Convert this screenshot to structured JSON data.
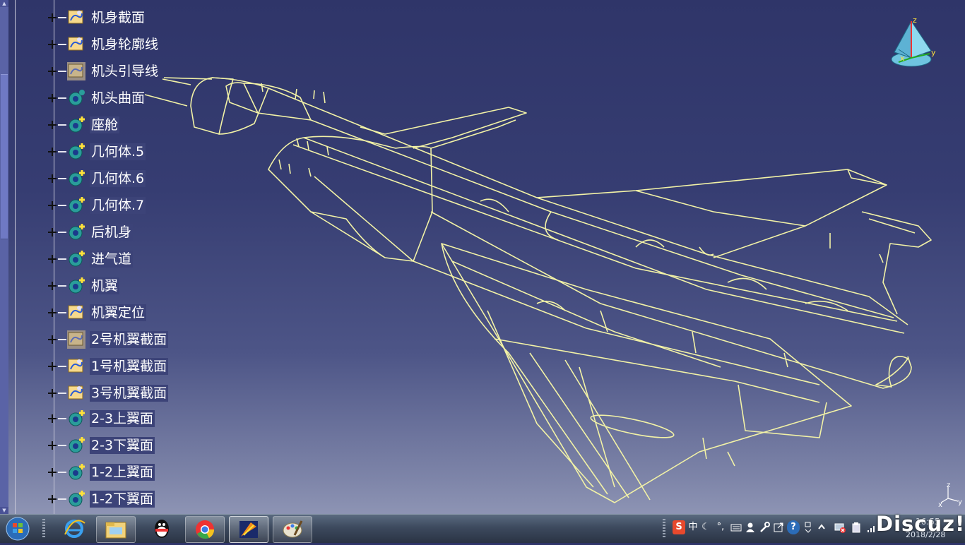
{
  "tree": {
    "items": [
      {
        "label": "机身截面",
        "icon": "sketch-icon",
        "highlighted": false
      },
      {
        "label": "机身轮廓线",
        "icon": "sketch-icon",
        "highlighted": false
      },
      {
        "label": "机头引导线",
        "icon": "hidden-sketch-icon",
        "highlighted": false
      },
      {
        "label": "机头曲面",
        "icon": "geometrical-set-icon",
        "highlighted": false
      },
      {
        "label": "座舱",
        "icon": "geometrical-set-icon",
        "highlighted": true
      },
      {
        "label": "几何体.5",
        "icon": "geometrical-set-icon",
        "highlighted": true
      },
      {
        "label": "几何体.6",
        "icon": "geometrical-set-icon",
        "highlighted": true
      },
      {
        "label": "几何体.7",
        "icon": "geometrical-set-icon",
        "highlighted": true
      },
      {
        "label": "后机身",
        "icon": "geometrical-set-icon",
        "highlighted": true
      },
      {
        "label": "进气道",
        "icon": "geometrical-set-icon",
        "highlighted": true
      },
      {
        "label": "机翼",
        "icon": "geometrical-set-icon",
        "highlighted": true
      },
      {
        "label": "机翼定位",
        "icon": "sketch-icon",
        "highlighted": true
      },
      {
        "label": "2号机翼截面",
        "icon": "hidden-sketch-icon",
        "highlighted": true
      },
      {
        "label": "1号机翼截面",
        "icon": "sketch-icon",
        "highlighted": true
      },
      {
        "label": "3号机翼截面",
        "icon": "sketch-icon",
        "highlighted": true
      },
      {
        "label": "2-3上翼面",
        "icon": "geometrical-set-icon",
        "highlighted": true
      },
      {
        "label": "2-3下翼面",
        "icon": "geometrical-set-icon",
        "highlighted": true
      },
      {
        "label": "1-2上翼面",
        "icon": "geometrical-set-icon",
        "highlighted": true
      },
      {
        "label": "1-2下翼面",
        "icon": "geometrical-set-icon",
        "highlighted": true
      }
    ]
  },
  "compass": {
    "x_label": "x",
    "y_label": "y",
    "z_label": "z"
  },
  "mini_axis": {
    "x_label": "x",
    "y_label": "y",
    "z_label": "z"
  },
  "colors": {
    "wireframe": "#f2f2a6",
    "background_top": "#2f3569",
    "background_bottom": "#9aa0bd",
    "label_highlight": "#3c4378"
  },
  "taskbar": {
    "apps": [
      {
        "name": "internet-explorer-icon"
      },
      {
        "name": "file-explorer-icon"
      },
      {
        "name": "qq-icon"
      },
      {
        "name": "chrome-icon"
      },
      {
        "name": "catia-icon"
      },
      {
        "name": "paint-icon"
      }
    ],
    "tray": {
      "ime_logo": "S",
      "ime_mode": "中",
      "moon": "☾",
      "punct": "°,",
      "help": "?"
    },
    "clock_time": "16:55",
    "clock_date": "2018/2/28",
    "watermark": "Discuz!"
  }
}
